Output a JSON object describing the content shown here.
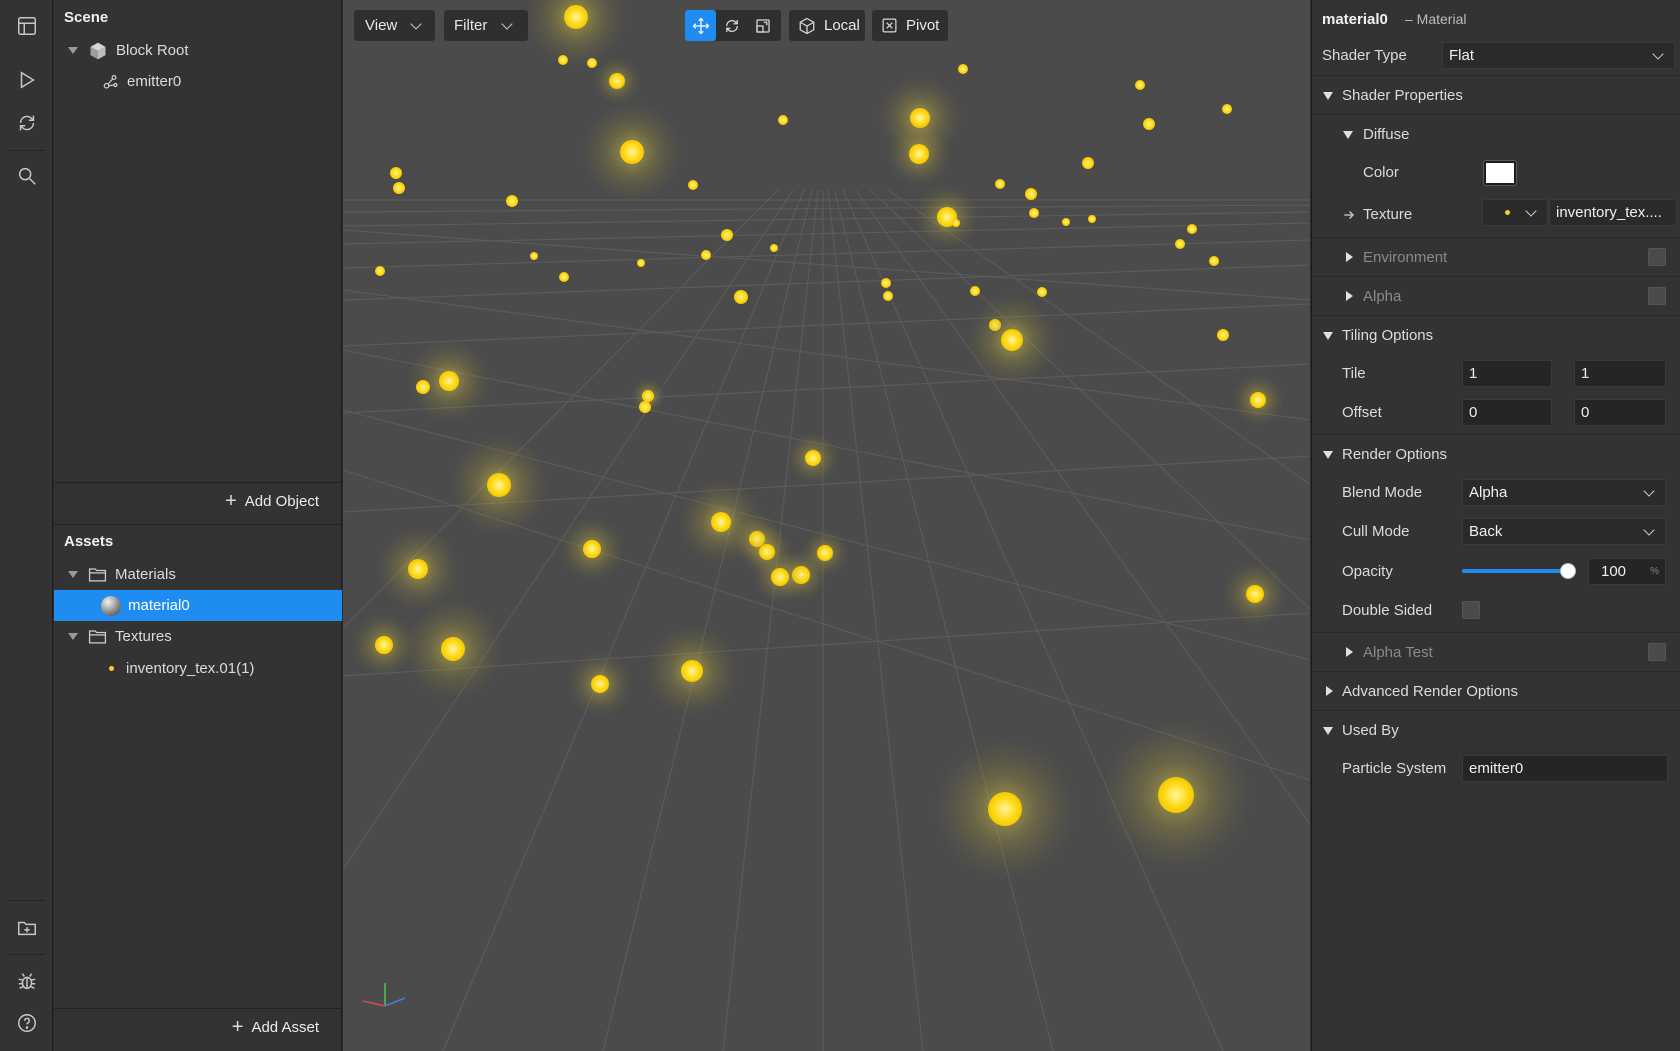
{
  "rail": {
    "icons": [
      "layout-icon",
      "play-icon",
      "refresh-icon",
      "search-icon",
      "add-folder-icon",
      "bug-icon",
      "help-icon"
    ]
  },
  "scene": {
    "title": "Scene",
    "items": [
      {
        "label": "Block Root",
        "icon": "cube-icon"
      },
      {
        "label": "emitter0",
        "icon": "emitter-icon"
      }
    ],
    "add_object": "Add Object"
  },
  "assets": {
    "title": "Assets",
    "folders": [
      {
        "label": "Materials",
        "children": [
          {
            "label": "material0",
            "selected": true
          }
        ]
      },
      {
        "label": "Textures",
        "children": [
          {
            "label": "inventory_tex.01(1)",
            "selected": false
          }
        ]
      }
    ],
    "add_asset": "Add Asset"
  },
  "toolbar": {
    "view": "View",
    "filter": "Filter",
    "local": "Local",
    "pivot": "Pivot",
    "active_tool": "move"
  },
  "inspector": {
    "name": "material0",
    "type": "– Material",
    "shader_type_label": "Shader Type",
    "shader_type": "Flat",
    "shader_properties": "Shader Properties",
    "diffuse": "Diffuse",
    "color_label": "Color",
    "color_value": "#ffffff",
    "texture_label": "Texture",
    "texture_value": "inventory_tex....",
    "environment": "Environment",
    "alpha": "Alpha",
    "tiling_options": "Tiling Options",
    "tile_label": "Tile",
    "tile_x": "1",
    "tile_y": "1",
    "offset_label": "Offset",
    "offset_x": "0",
    "offset_y": "0",
    "render_options": "Render Options",
    "blend_mode_label": "Blend Mode",
    "blend_mode": "Alpha",
    "cull_mode_label": "Cull Mode",
    "cull_mode": "Back",
    "opacity_label": "Opacity",
    "opacity_value": "100",
    "opacity_unit": "%",
    "opacity_fraction": 1.0,
    "double_sided": "Double Sided",
    "alpha_test": "Alpha Test",
    "advanced_render_options": "Advanced Render Options",
    "used_by": "Used By",
    "particle_system_label": "Particle System",
    "particle_system_value": "emitter0"
  },
  "colors": {
    "accent": "#1e8cf0",
    "particle": "#ffdd22",
    "viewport_bg": "#4b4b4b"
  }
}
